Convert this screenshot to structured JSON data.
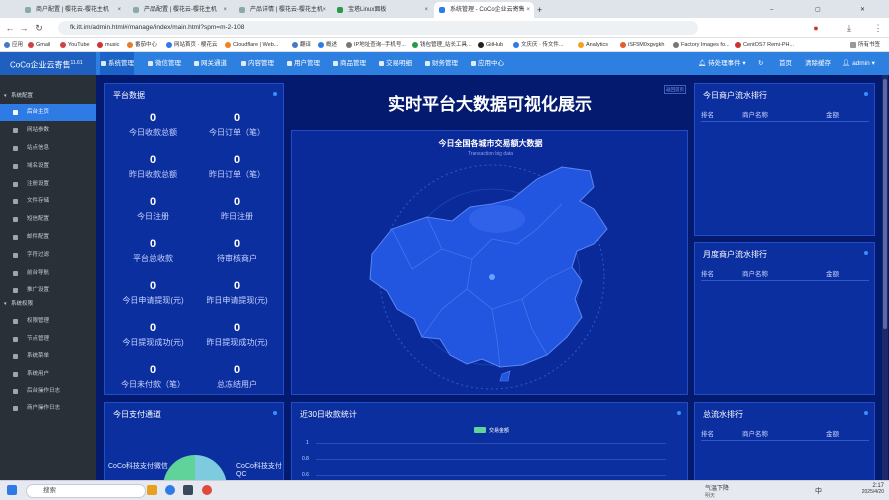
{
  "browser": {
    "tabs": [
      {
        "title": "商户配置 | 樱花云-樱花主机"
      },
      {
        "title": "产品配置 | 樱花云-樱花主机"
      },
      {
        "title": "产品详情 | 樱花云-樱花主机"
      },
      {
        "title": "宝塔Linux面板"
      },
      {
        "title": "系统管理 - CoCo企业云寄售"
      }
    ],
    "new_tab": "+",
    "url": "fk.itt.im/admin.html#/manage/index/main.html?spm=m-2-108",
    "bookmarks": [
      "应用",
      "Gmail",
      "YouTube",
      "music",
      "番茄中心",
      "网站首页 · 樱花云",
      "Cloudflare | Web...",
      "翻译",
      "概述",
      "IP地址查询--手机号...",
      "钱包管理_站长工具...",
      "GitHub",
      "文庆庆 · 传文件...",
      "Analytics",
      "iSF5M0xgvgkh",
      "Factory Images fo...",
      "CentOS7 Remi-PH..."
    ],
    "all_bookmarks": "所有书签"
  },
  "app": {
    "brand": "CoCo企业云寄售",
    "version": "11.61",
    "nav": [
      "系统管理",
      "微信管理",
      "网关通道",
      "内容管理",
      "用户管理",
      "商品管理",
      "交易明细",
      "财务管理",
      "应用中心"
    ],
    "right_nav": [
      "待处理事件",
      "",
      "首页",
      "清除缓存",
      "admin"
    ]
  },
  "sidebar": {
    "groups": [
      "系统配置",
      "系统权限"
    ],
    "items1": [
      "后台主页",
      "网站参数",
      "站点信息",
      "域名设置",
      "注册设置",
      "文件存储",
      "短信配置",
      "邮件配置",
      "字符过滤",
      "前台导航",
      "推广设置"
    ],
    "items2": [
      "权限管理",
      "节点管理",
      "系统菜单",
      "系统用户",
      "后台操作日志",
      "商户操作日志"
    ]
  },
  "dashboard": {
    "platform_title": "平台数据",
    "stats": [
      {
        "value": "0",
        "label": "今日收款总额"
      },
      {
        "value": "0",
        "label": "今日订单（笔）"
      },
      {
        "value": "0",
        "label": "昨日收款总额"
      },
      {
        "value": "0",
        "label": "昨日订单（笔）"
      },
      {
        "value": "0",
        "label": "今日注册"
      },
      {
        "value": "0",
        "label": "昨日注册"
      },
      {
        "value": "0",
        "label": "平台总收款"
      },
      {
        "value": "0",
        "label": "待审核商户"
      },
      {
        "value": "0",
        "label": "今日申请提现(元)"
      },
      {
        "value": "0",
        "label": "昨日申请提现(元)"
      },
      {
        "value": "0",
        "label": "今日提现成功(元)"
      },
      {
        "value": "0",
        "label": "昨日提现成功(元)"
      },
      {
        "value": "0",
        "label": "今日未付款（笔）"
      },
      {
        "value": "0",
        "label": "总冻结用户"
      }
    ],
    "center_title": "实时平台大数据可视化展示",
    "center_tag": "返回首页",
    "map_title": "今日全国各城市交易额大数据",
    "map_subtitle": "Transaction big data",
    "today_rank_title": "今日商户流水排行",
    "month_rank_title": "月度商户流水排行",
    "total_rank_title": "总流水排行",
    "rank_headers": [
      "排名",
      "商户名称",
      "金额"
    ],
    "pay_channel_title": "今日支付通道",
    "pay_left": "CoCo科技支付微信",
    "pay_right": "CoCo科技支付QC",
    "thirty_day_title": "近30日收款统计",
    "legend_label": "交易金额",
    "y_ticks": [
      "1",
      "0.8",
      "0.6"
    ]
  },
  "colors": {
    "accent": "#2f7be6",
    "panel": "#0c2fa0",
    "bg": "#031a6e",
    "legend": "#5fd39a"
  },
  "taskbar": {
    "search_placeholder": "搜索",
    "weather": "气温下降",
    "weather_sub": "明天",
    "time": "2:17",
    "date": "2025/4/20",
    "ime": "中"
  }
}
